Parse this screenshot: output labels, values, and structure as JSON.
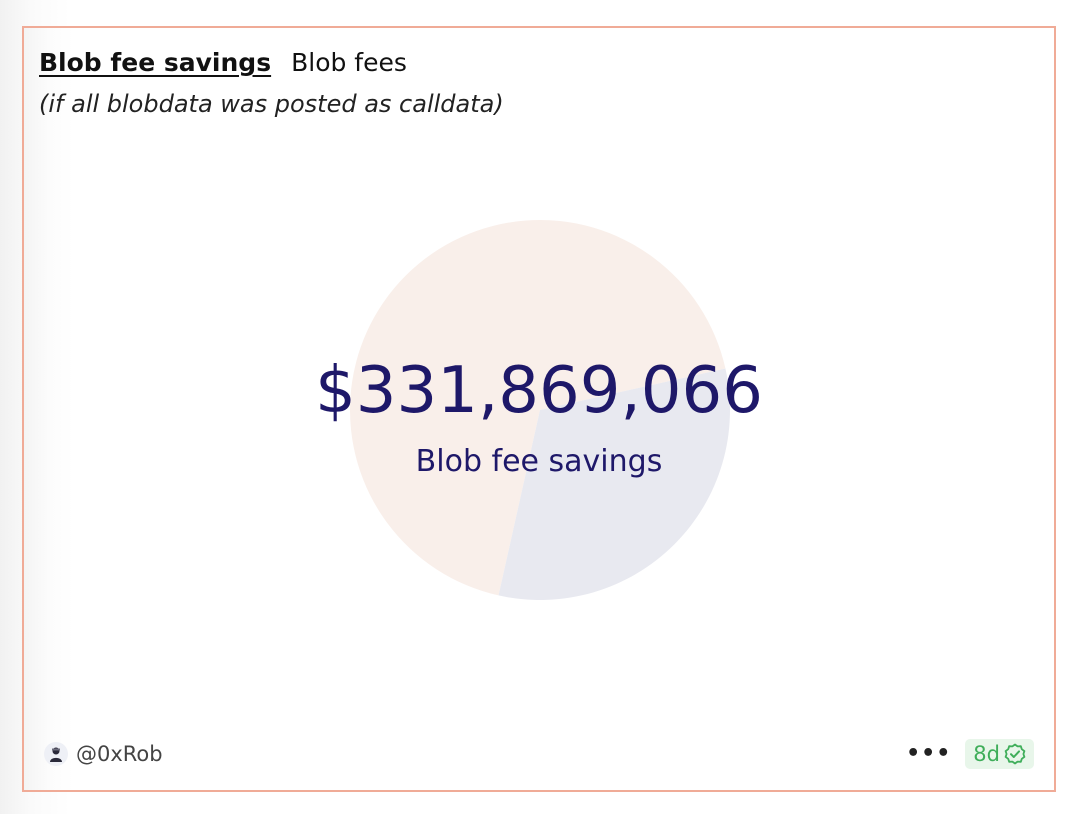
{
  "tabs": {
    "active_label": "Blob fee savings",
    "other_label": "Blob fees"
  },
  "subtitle": "(if all blobdata was posted as calldata)",
  "counter": {
    "value": "$331,869,066",
    "label": "Blob fee savings"
  },
  "footer": {
    "author": "@0xRob",
    "age": "8d",
    "more_icon": "ellipsis-icon",
    "verified_icon": "check-circle-icon"
  },
  "colors": {
    "border": "#f0ab97",
    "text_accent": "#1e1869",
    "slice_savings": "#f9efea",
    "slice_fees": "#e8e9f0",
    "badge_text": "#3fae5a",
    "badge_bg": "#e8f6ea"
  },
  "chart_data": {
    "type": "pie",
    "values": [
      0.68,
      0.32
    ],
    "colors": [
      "#f9efea",
      "#e8e9f0"
    ]
  }
}
